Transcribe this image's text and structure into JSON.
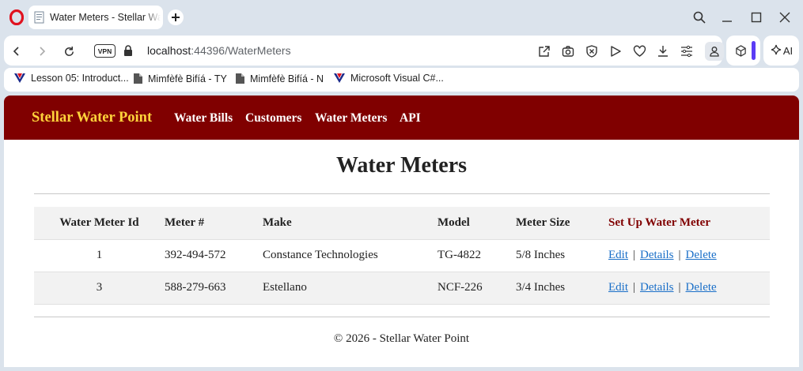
{
  "browser": {
    "tab": {
      "title": "Water Meters - Stellar Water Point"
    },
    "address": {
      "host": "localhost",
      "path": ":44396/WaterMeters"
    },
    "ai_label": "AI",
    "bookmarks": [
      {
        "label": "Lesson 05: Introduct...",
        "icon": "vs-icon"
      },
      {
        "label": "Mimfèfè Bifíá - TY",
        "icon": "doc-icon"
      },
      {
        "label": "Mimfèfè Bifíá - N",
        "icon": "doc-icon"
      },
      {
        "label": "Microsoft Visual C#...",
        "icon": "vs-icon"
      }
    ]
  },
  "site": {
    "brand": "Stellar Water Point",
    "nav": [
      "Water Bills",
      "Customers",
      "Water Meters",
      "API"
    ],
    "brand_color": "#800000",
    "brand_text_color": "#ffd43b"
  },
  "main": {
    "title": "Water Meters",
    "table": {
      "headers": [
        "Water Meter Id",
        "Meter #",
        "Make",
        "Model",
        "Meter Size",
        "Set Up Water Meter"
      ],
      "rows": [
        {
          "id": "1",
          "meter": "392-494-572",
          "make": "Constance Technologies",
          "model": "TG-4822",
          "size": "5/8 Inches"
        },
        {
          "id": "3",
          "meter": "588-279-663",
          "make": "Estellano",
          "model": "NCF-226",
          "size": "3/4 Inches"
        }
      ],
      "actions": {
        "edit": "Edit",
        "details": "Details",
        "delete": "Delete",
        "separator": "|"
      }
    }
  },
  "footer": {
    "text": "© 2026 - Stellar Water Point"
  }
}
